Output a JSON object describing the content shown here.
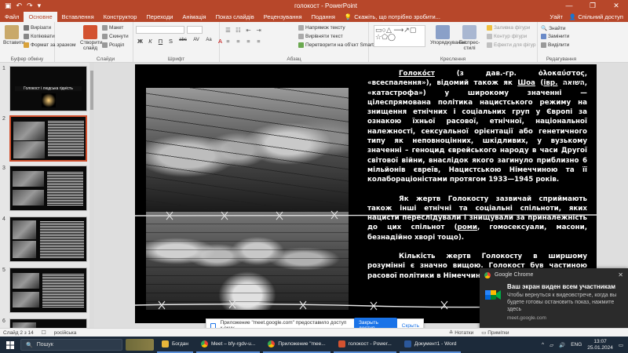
{
  "app": {
    "title": "голокост - PowerPoint",
    "quick_access": [
      "↶",
      "↷",
      "▣",
      "▾"
    ],
    "window_controls": [
      "—",
      "❐",
      "✕"
    ]
  },
  "tabs": [
    {
      "label": "Файл"
    },
    {
      "label": "Основне",
      "active": true
    },
    {
      "label": "Вставлення"
    },
    {
      "label": "Конструктор"
    },
    {
      "label": "Переходи"
    },
    {
      "label": "Анімація"
    },
    {
      "label": "Показ слайдів"
    },
    {
      "label": "Рецензування"
    },
    {
      "label": "Подання"
    }
  ],
  "tell_me": "Скажіть, що потрібно зробити...",
  "account": {
    "signin": "Уайт",
    "share": "Спільний доступ"
  },
  "ribbon": {
    "clipboard": {
      "paste": "Вставити",
      "cut": "Вирізати",
      "copy": "Копіювати",
      "format_painter": "Формат за зразком",
      "label": "Буфер обміну"
    },
    "slides": {
      "new_slide": "Створити слайд",
      "layout": "Макет",
      "reset": "Скинути",
      "section": "Розділ",
      "label": "Слайди"
    },
    "font": {
      "label": "Шрифт",
      "buttons": [
        "Ж",
        "К",
        "П",
        "S",
        "abc",
        "AV",
        "Aa",
        "A"
      ]
    },
    "paragraph": {
      "text_direction": "Напрямок тексту",
      "align_text": "Вирівняти текст",
      "smartart": "Перетворити на об'єкт SmartArt",
      "label": "Абзац"
    },
    "drawing": {
      "arrange": "Упорядкування",
      "quick_styles": "Експрес-стилі",
      "fill": "Заливка фігури",
      "outline": "Контур фігури",
      "effects": "Ефекти для фігур",
      "label": "Креслення"
    },
    "editing": {
      "find": "Знайти",
      "replace": "Замінити",
      "select": "Виділити",
      "label": "Редагування"
    }
  },
  "thumbnails": [
    {
      "num": "1",
      "title": "Голокост і людська гідність"
    },
    {
      "num": "2"
    },
    {
      "num": "3"
    },
    {
      "num": "4"
    },
    {
      "num": "5"
    },
    {
      "num": "6"
    }
  ],
  "slide": {
    "p1": {
      "term": "Голоко́ст",
      "a": " (з дав.-гр. ὁλοκαύστος, «всеспалення»), відомий також як ",
      "shoah": "Шоа",
      "b": " (",
      "heb": "івр.",
      "c": " השואה‎, «катастрофа») у широкому значенні — цілеспрямована політика нацистського режиму на знищення етнічних і соціальних груп у Європі за ознакою їхньої расової, етнічної, національної належності, сексуальної орієнтації або генетичного типу як неповноцінних, шкідливих, у вузькому значенні – геноцид єврейського народу в часи Другої світової війни, внаслідок якого загинуло приблизно 6 мільйонів євреїв, Нацистською Німеччиною та її колабораціоністами протягом 1933—1945 років."
    },
    "p2": {
      "a": "Як жертв Голокосту зазвичай сприймають також інші етнічні та соціальні спільноти, яких нацисти переслідували і знищували за приналежність до цих спільнот (",
      "roma": "роми",
      "b": ", гомосексуали, масони, безнадійно хворі тощо)."
    },
    "p3": "Кількість жертв Голокосту в ширшому розумінні є значно вищою. Голокост був частиною расової політики в Німеччині НСДАП."
  },
  "share_bar": {
    "text": "Приложение \"meet.google.com\" предоставило доступ к окну.",
    "stop": "Закрыть доступ",
    "hide": "Скрыть"
  },
  "toast": {
    "app": "Google Chrome",
    "title": "Ваш экран виден всем участникам",
    "message": "Чтобы вернуться к видеовстрече, когда вы будете готовы остановить показ, нажмите здесь",
    "source": "meet.google.com"
  },
  "status": {
    "slide_of": "Слайд 2 з 14",
    "lang": "російська",
    "notes": "Нотатки",
    "comments": "Примітки"
  },
  "taskbar": {
    "search": "Пошук",
    "apps": [
      {
        "label": "Богдан",
        "color": "#e8b53a"
      },
      {
        "label": "Meet – bfy-rgdv-u...",
        "color": "#34a853"
      },
      {
        "label": "Приложение \"mee...",
        "color": "#4285f4"
      },
      {
        "label": "голокост - Power...",
        "color": "#d35230"
      },
      {
        "label": "Документ1 - Word",
        "color": "#2b579a"
      }
    ],
    "lang": "ENG",
    "time": "13:07",
    "date": "25.01.2024"
  }
}
